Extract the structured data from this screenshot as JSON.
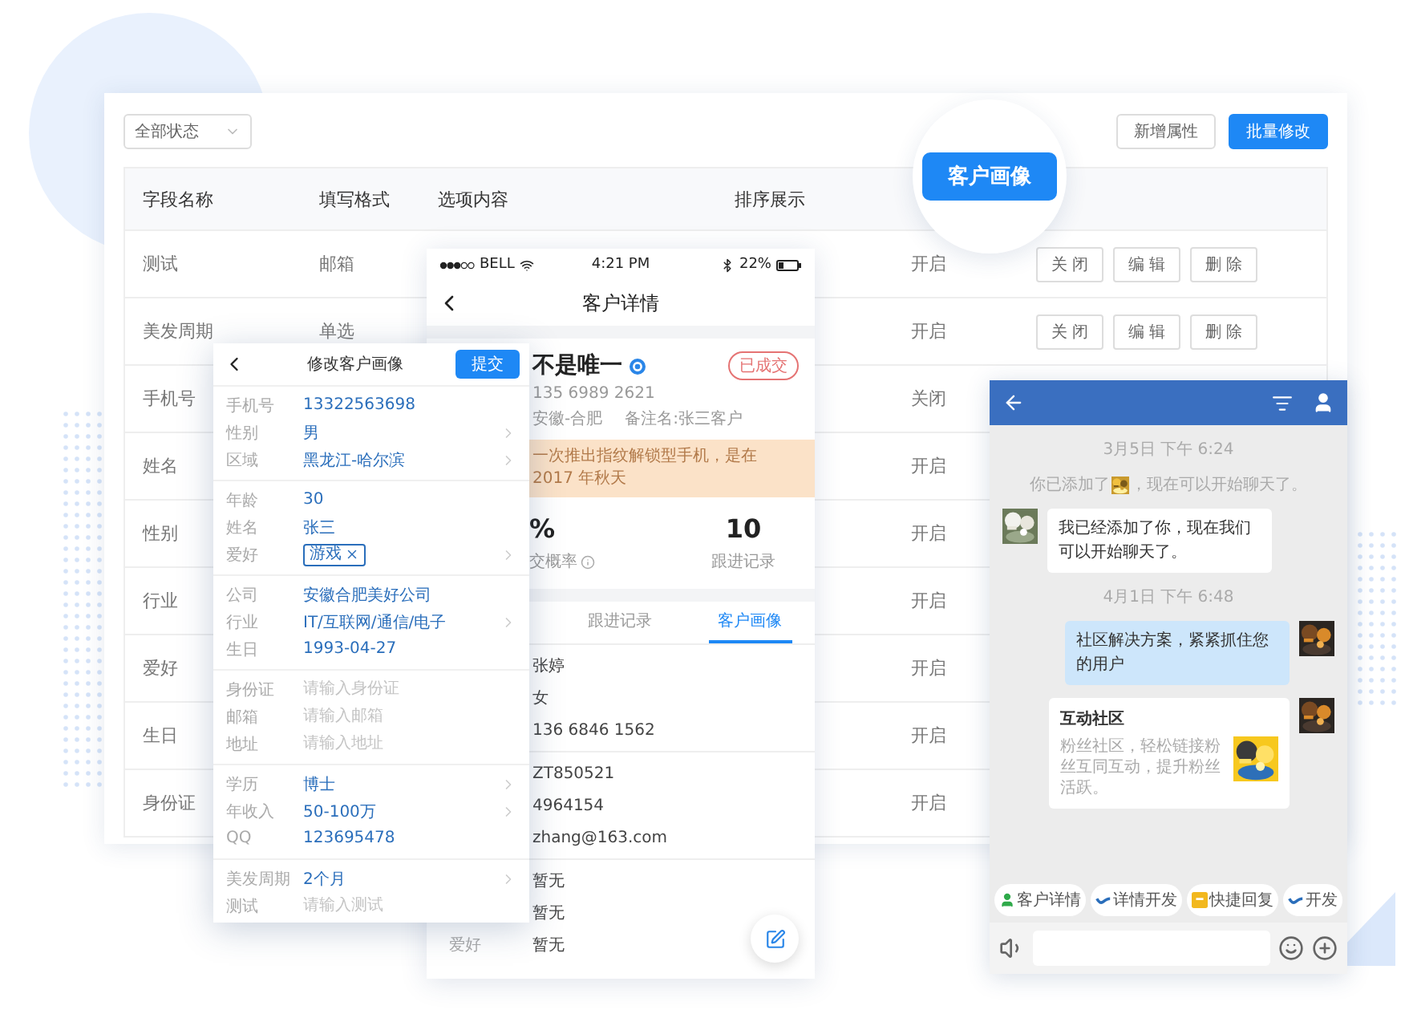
{
  "admin": {
    "filter": {
      "value": "全部状态"
    },
    "buttons": [
      {
        "label": "新增属性",
        "primary": false
      },
      {
        "label": "批量修改",
        "primary": true
      }
    ],
    "columns": [
      "字段名称",
      "填写格式",
      "选项内容",
      "排序展示"
    ],
    "rows": [
      {
        "name": "测试",
        "format": "邮箱",
        "status": "开启",
        "actions": [
          "关闭",
          "编辑",
          "删除"
        ]
      },
      {
        "name": "美发周期",
        "format": "单选",
        "status": "开启",
        "actions": [
          "关闭",
          "编辑",
          "删除"
        ]
      },
      {
        "name": "手机号",
        "status": "关闭"
      },
      {
        "name": "姓名",
        "status": "开启"
      },
      {
        "name": "性别",
        "status": "开启"
      },
      {
        "name": "行业",
        "status": "开启"
      },
      {
        "name": "爱好",
        "status": "开启"
      },
      {
        "name": "生日",
        "status": "开启"
      },
      {
        "name": "身份证",
        "status": "开启"
      }
    ]
  },
  "callout": {
    "label": "客户画像"
  },
  "detail_phone": {
    "status_bar": {
      "carrier": "BELL",
      "time": "4:21 PM",
      "battery": "22%"
    },
    "title": "客户详情",
    "profile": {
      "name": "不是唯一",
      "verified": true,
      "badge": "已成交",
      "phone": "135 6989 2621",
      "location": "安徽-合肥",
      "remark": "备注名:张三客户",
      "notice": "一次推出指纹解锁型手机，是在 2017 年秋天"
    },
    "stats": [
      {
        "value": "%",
        "label": "交概率",
        "info": true
      },
      {
        "value": "10",
        "label": "跟进记录",
        "info": false
      }
    ],
    "tabs": [
      {
        "label": "跟进记录",
        "selected": false
      },
      {
        "label": "客户画像",
        "selected": true
      }
    ],
    "fields": [
      [
        {
          "value": "张婷"
        },
        {
          "value": "女"
        },
        {
          "value": "136 6846 1562"
        }
      ],
      [
        {
          "value": "ZT850521"
        },
        {
          "value": "4964154"
        },
        {
          "value": "zhang@163.com"
        }
      ],
      [
        {
          "value": "暂无"
        },
        {
          "value": "暂无"
        },
        {
          "label": "爱好",
          "value": "暂无"
        }
      ]
    ]
  },
  "edit_phone": {
    "title": "修改客户画像",
    "submit": "提交",
    "groups": [
      [
        {
          "label": "手机号",
          "value": "13322563698",
          "arrow": false
        },
        {
          "label": "性别",
          "value": "男",
          "arrow": true
        },
        {
          "label": "区域",
          "value": "黑龙江-哈尔滨",
          "arrow": true
        }
      ],
      [
        {
          "label": "年龄",
          "value": "30",
          "arrow": false
        },
        {
          "label": "姓名",
          "value": "张三",
          "arrow": false
        },
        {
          "label": "爱好",
          "tag": "游戏",
          "arrow": true
        }
      ],
      [
        {
          "label": "公司",
          "value": "安徽合肥美好公司",
          "arrow": false
        },
        {
          "label": "行业",
          "value": "IT/互联网/通信/电子",
          "arrow": true
        },
        {
          "label": "生日",
          "value": "1993-04-27",
          "arrow": false
        }
      ],
      [
        {
          "label": "身份证",
          "placeholder": "请输入身份证",
          "arrow": false
        },
        {
          "label": "邮箱",
          "placeholder": "请输入邮箱",
          "arrow": false
        },
        {
          "label": "地址",
          "placeholder": "请输入地址",
          "arrow": false
        }
      ],
      [
        {
          "label": "学历",
          "value": "博士",
          "arrow": true
        },
        {
          "label": "年收入",
          "value": "50-100万",
          "arrow": true
        },
        {
          "label": "QQ",
          "value": "123695478",
          "arrow": false
        }
      ],
      [
        {
          "label": "美发周期",
          "value": "2个月",
          "arrow": true
        },
        {
          "label": "测试",
          "placeholder": "请输入测试",
          "arrow": false
        }
      ]
    ]
  },
  "chat": {
    "messages": [
      {
        "kind": "time",
        "text": "3月5日 下午 6:24"
      },
      {
        "kind": "system",
        "before": "你已添加了",
        "after": "，现在可以开始聊天了。"
      },
      {
        "kind": "incoming",
        "text": "我已经添加了你，现在我们可以开始聊天了。"
      },
      {
        "kind": "time",
        "text": "4月1日 下午 6:48"
      },
      {
        "kind": "outgoing",
        "text": "社区解决方案，紧紧抓住您的用户"
      },
      {
        "kind": "card",
        "title": "互动社区",
        "text": "粉丝社区，轻松链接粉丝互同互动，提升粉丝活跃。"
      }
    ],
    "quick_actions": [
      {
        "label": "客户详情",
        "kind": "person"
      },
      {
        "label": "详情开发",
        "kind": "wave"
      },
      {
        "label": "快捷回复",
        "kind": "square"
      },
      {
        "label": "开发",
        "kind": "wave"
      }
    ]
  }
}
